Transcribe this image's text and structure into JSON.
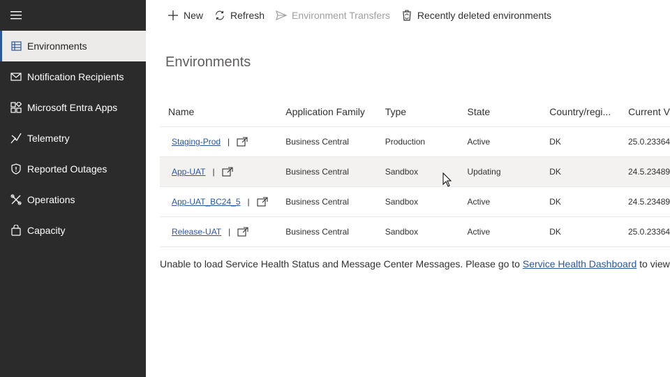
{
  "sidebar": {
    "menu_icon": "hamburger-icon",
    "items": [
      {
        "label": "Environments",
        "icon": "table-icon",
        "selected": true
      },
      {
        "label": "Notification Recipients",
        "icon": "mail-icon"
      },
      {
        "label": "Microsoft Entra Apps",
        "icon": "apps-icon"
      },
      {
        "label": "Telemetry",
        "icon": "telemetry-icon"
      },
      {
        "label": "Reported Outages",
        "icon": "shield-alert-icon"
      },
      {
        "label": "Operations",
        "icon": "operations-icon"
      },
      {
        "label": "Capacity",
        "icon": "bag-icon"
      }
    ]
  },
  "toolbar": {
    "new_label": "New",
    "refresh_label": "Refresh",
    "transfers_label": "Environment Transfers",
    "deleted_label": "Recently deleted environments"
  },
  "page": {
    "title": "Environments"
  },
  "table": {
    "headers": {
      "name": "Name",
      "family": "Application Family",
      "type": "Type",
      "state": "State",
      "country": "Country/regi...",
      "version": "Current V"
    },
    "rows": [
      {
        "name": "Staging-Prod",
        "family": "Business Central",
        "type": "Production",
        "state": "Active",
        "country": "DK",
        "version": "25.0.23364"
      },
      {
        "name": "App-UAT",
        "family": "Business Central",
        "type": "Sandbox",
        "state": "Updating",
        "country": "DK",
        "version": "24.5.23489"
      },
      {
        "name": "App-UAT_BC24_5",
        "family": "Business Central",
        "type": "Sandbox",
        "state": "Active",
        "country": "DK",
        "version": "24.5.23489"
      },
      {
        "name": "Release-UAT",
        "family": "Business Central",
        "type": "Sandbox",
        "state": "Active",
        "country": "DK",
        "version": "25.0.23364"
      }
    ],
    "separator": "|"
  },
  "message": {
    "before": "Unable to load Service Health Status and Message Center Messages. Please go to ",
    "link": "Service Health Dashboard",
    "after": " to view service"
  },
  "colors": {
    "sidebar_bg": "#2b2b2b",
    "accent": "#2b579a",
    "selected_bg": "#edebe9"
  }
}
